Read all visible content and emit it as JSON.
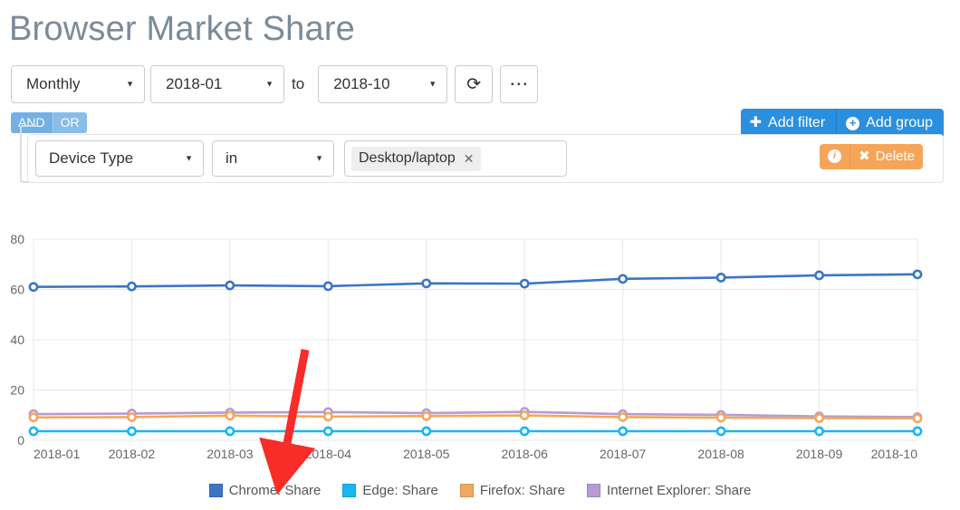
{
  "header": {
    "title": "Browser Market Share"
  },
  "toolbar": {
    "granularity": "Monthly",
    "date_from": "2018-01",
    "to_label": "to",
    "date_to": "2018-10",
    "refresh_icon": "refresh-icon",
    "more_icon": "ellipsis-icon"
  },
  "logic": {
    "and_label": "AND",
    "or_label": "OR"
  },
  "actions": {
    "add_filter_label": "Add filter",
    "add_filter_icon": "plus-icon",
    "add_group_label": "Add group",
    "add_group_icon": "circle-plus-icon"
  },
  "filter": {
    "field": "Device Type",
    "operator": "in",
    "value_tag": "Desktop/laptop",
    "tag_remove_icon": "close-icon",
    "info_icon": "info-icon",
    "delete_label": "Delete",
    "delete_icon": "cross-icon"
  },
  "annotation": {
    "arrow_color": "#f82c29",
    "arrow_name": "red-arrow-annotation"
  },
  "colors": {
    "chrome": "#3a76c4",
    "edge": "#18b7f0",
    "firefox": "#f0a95c",
    "ie": "#b79ad4",
    "primary_blue": "#2b8fe0",
    "orange": "#f5a55a",
    "grid": "#e8e8e8"
  },
  "chart_data": {
    "type": "line",
    "title": "Browser Market Share",
    "xlabel": "",
    "ylabel": "",
    "ylim": [
      0,
      80
    ],
    "yticks": [
      0,
      20,
      40,
      60,
      80
    ],
    "grid": true,
    "legend_position": "bottom",
    "categories": [
      "2018-01",
      "2018-02",
      "2018-03",
      "2018-04",
      "2018-05",
      "2018-06",
      "2018-07",
      "2018-08",
      "2018-09",
      "2018-10"
    ],
    "series": [
      {
        "name": "Chrome: Share",
        "color": "#3a76c4",
        "values": [
          61.0,
          61.2,
          61.6,
          61.3,
          62.4,
          62.3,
          64.2,
          64.7,
          65.6,
          66.0
        ]
      },
      {
        "name": "Edge: Share",
        "color": "#18b7f0",
        "values": [
          3.6,
          3.6,
          3.6,
          3.6,
          3.6,
          3.6,
          3.6,
          3.6,
          3.6,
          3.6
        ]
      },
      {
        "name": "Firefox: Share",
        "color": "#f0a95c",
        "values": [
          9.1,
          9.2,
          9.8,
          9.4,
          9.6,
          9.9,
          9.2,
          9.0,
          8.8,
          8.7
        ]
      },
      {
        "name": "Internet Explorer: Share",
        "color": "#b79ad4",
        "values": [
          10.4,
          10.6,
          11.0,
          11.2,
          10.8,
          11.3,
          10.4,
          10.1,
          9.5,
          9.2
        ]
      }
    ]
  }
}
